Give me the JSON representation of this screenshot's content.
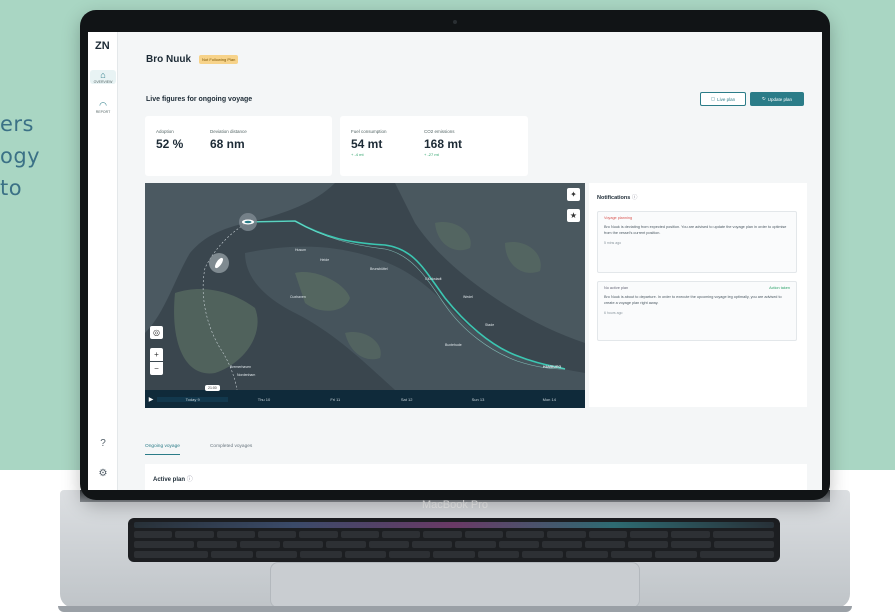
{
  "side_text": [
    "ers",
    "ogy",
    "to"
  ],
  "laptop": {
    "brand": "MacBook Pro"
  },
  "app": {
    "logo": "ZN",
    "rail": [
      {
        "label": "Overview",
        "icon": "home-icon"
      },
      {
        "label": "Report",
        "icon": "gauge-icon"
      }
    ],
    "vessel": "Bro Nuuk",
    "status_badge": "Not Following Plan",
    "section_title": "Live figures for ongoing voyage",
    "buttons": {
      "live_plan": "Live plan",
      "update_plan": "Update plan"
    },
    "kpis": [
      {
        "label": "Adoption",
        "value": "52 %",
        "delta": ""
      },
      {
        "label": "Deviation distance",
        "value": "68 nm",
        "delta": ""
      },
      {
        "label": "Fuel consumption",
        "value": "54 mt",
        "delta": "+ -4 mt"
      },
      {
        "label": "CO2 emissions",
        "value": "168 mt",
        "delta": "+ -27 mt"
      }
    ],
    "map": {
      "now_tag": "21:00",
      "timeline": [
        "Today 9",
        "Thu 10",
        "Fri 11",
        "Sat 12",
        "Sun 13",
        "Mon 14"
      ],
      "places": [
        "Husum",
        "Heide",
        "Brunsbüttel",
        "Glückstadt",
        "Wedel",
        "Cuxhaven",
        "Stade",
        "Buxtehude",
        "HAMBURG",
        "Bremerhaven",
        "Nordenham"
      ]
    },
    "notifications": {
      "title": "Notifications",
      "items": [
        {
          "tag": "Voyage planning",
          "action": "",
          "body": "Bro Nuuk is deviating from expected position. You are advised to update the voyage plan in order to optimise from the vessel's current position.",
          "time": "5 mins ago",
          "color": "#d9534f"
        },
        {
          "tag": "No active plan",
          "action": "Action taken",
          "body": "Bro Nuuk is about to departure. In order to execute the upcoming voyage leg optimally, you are advised to create a voyage plan right away.",
          "time": "6 hours ago",
          "color": "#2ea36b"
        }
      ]
    },
    "tabs": [
      "Ongoing voyage",
      "Completed voyages"
    ],
    "active_plan": "Active plan"
  }
}
